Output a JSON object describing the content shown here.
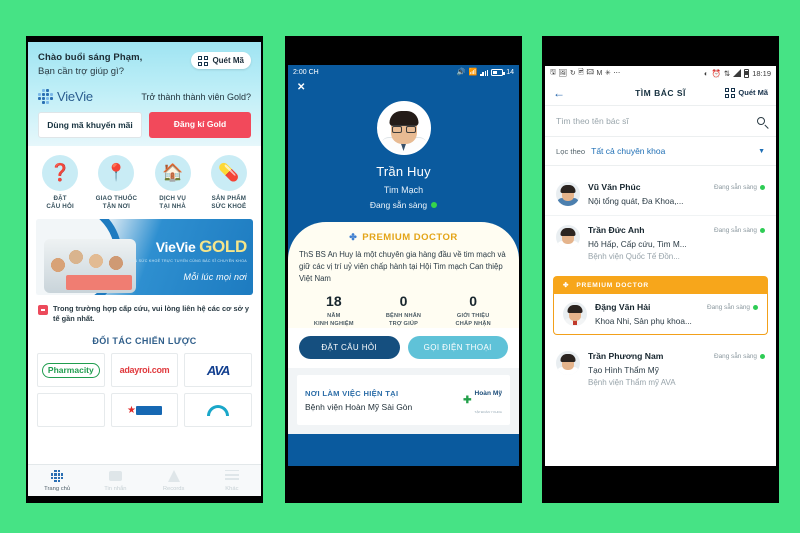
{
  "background_color": "#46e385",
  "phone_home": {
    "greeting_line1": "Chào buổi sáng Phạm,",
    "greeting_line2": "Bạn cần trợ giúp gì?",
    "qr_button": "Quét Mã",
    "brand": "VieVie",
    "gold_question": "Trở thành thành viên Gold?",
    "promo_button": "Dùng mã khuyến mãi",
    "gold_button": "Đăng kí Gold",
    "actions": [
      {
        "label_line1": "ĐẶT",
        "label_line2": "CÂU HỎI",
        "icon": "question-bubble-icon",
        "glyph": "❓"
      },
      {
        "label_line1": "GIAO THUỐC",
        "label_line2": "TẬN NƠI",
        "icon": "map-pin-icon",
        "glyph": "📍"
      },
      {
        "label_line1": "DỊCH VỤ",
        "label_line2": "TẠI NHÀ",
        "icon": "house-icon",
        "glyph": "🏠"
      },
      {
        "label_line1": "SẢN PHẨM",
        "label_line2": "SỨC KHOẺ",
        "icon": "health-product-icon",
        "glyph": "💊"
      }
    ],
    "banner": {
      "title_plain": "VieVie ",
      "title_bold": "GOLD",
      "subtitle": "TƯ VẤN SỨC KHOẺ TRỰC TUYẾN CÙNG BÁC SĨ CHUYÊN KHOA",
      "tagline": "Mỗi lúc mọi nơi"
    },
    "emergency_note": "Trong trường hợp cấp cứu, vui lòng liên hệ các cơ sở y tế gần nhất.",
    "partners_title": "ĐỐI TÁC CHIẾN LƯỢC",
    "partners_row1": [
      "Pharmacity",
      "adayroi.com",
      "AVA"
    ],
    "tabbar": [
      {
        "label": "Trang chủ",
        "icon": "grid-dots-icon",
        "active": true
      },
      {
        "label": "Tin nhắn",
        "icon": "chat-bubble-icon",
        "active": false
      },
      {
        "label": "Records",
        "icon": "flask-icon",
        "active": false
      },
      {
        "label": "Khác",
        "icon": "menu-lines-icon",
        "active": false
      }
    ]
  },
  "phone_doctor": {
    "status_time": "2:00 CH",
    "battery_level": "14",
    "close_label": "✕",
    "doctor_name": "Trần Huy",
    "specialty": "Tim Mạch",
    "availability": "Đang sẵn sàng",
    "premium_label": "PREMIUM DOCTOR",
    "bio": "ThS BS An Huy là một chuyên gia hàng đầu về tim mạch và giữ các vị trí uỷ viên chấp hành tại Hội Tim mạch Can thiệp Việt Nam",
    "stats": [
      {
        "number": "18",
        "label_line1": "NĂM",
        "label_line2": "KINH NGHIỆM"
      },
      {
        "number": "0",
        "label_line1": "BỆNH NHÂN",
        "label_line2": "TRỢ GIÚP"
      },
      {
        "number": "0",
        "label_line1": "GIỚI THIỆU",
        "label_line2": "CHẤP NHẬN"
      }
    ],
    "primary_button": "ĐẶT CÂU HỎI",
    "secondary_button": "GỌI ĐIỆN THOẠI",
    "workplace_title": "NƠI LÀM VIỆC HIỆN TẠI",
    "workplace_name": "Bệnh viện Hoàn Mỹ Sài Gòn",
    "workplace_logo": "Hoàn Mỹ",
    "workplace_logo_sub": "TẬP ĐOÀN Y KHOA"
  },
  "phone_search": {
    "status_time": "18:19",
    "back_icon": "back-arrow-icon",
    "title": "TÌM BÁC SĨ",
    "qr_button": "Quét Mã",
    "search_placeholder": "Tìm theo tên bác sĩ",
    "filter_label": "Lọc theo",
    "filter_value": "Tất cả chuyên khoa",
    "premium_header": "PREMIUM DOCTOR",
    "doctors": [
      {
        "name": "Vũ Văn Phúc",
        "specialty": "Nội tổng quát, Đa Khoa,...",
        "hospital": "",
        "availability": "Đang sẵn sàng",
        "premium": false
      },
      {
        "name": "Trần Đức Anh",
        "specialty": "Hô Hấp, Cấp cứu, Tim M...",
        "hospital": "Bệnh viện Quốc Tế Đồn...",
        "availability": "Đang sẵn sàng",
        "premium": false
      },
      {
        "name": "Đặng Văn Hải",
        "specialty": "Khoa Nhi, Sản phụ khoa...",
        "hospital": "",
        "availability": "Đang sẵn sàng",
        "premium": true
      },
      {
        "name": "Trần Phương Nam",
        "specialty": "Tạo Hình Thẩm Mỹ",
        "hospital": "Bệnh viện Thẩm mỹ AVA",
        "availability": "Đang sẵn sàng",
        "premium": false
      }
    ]
  }
}
